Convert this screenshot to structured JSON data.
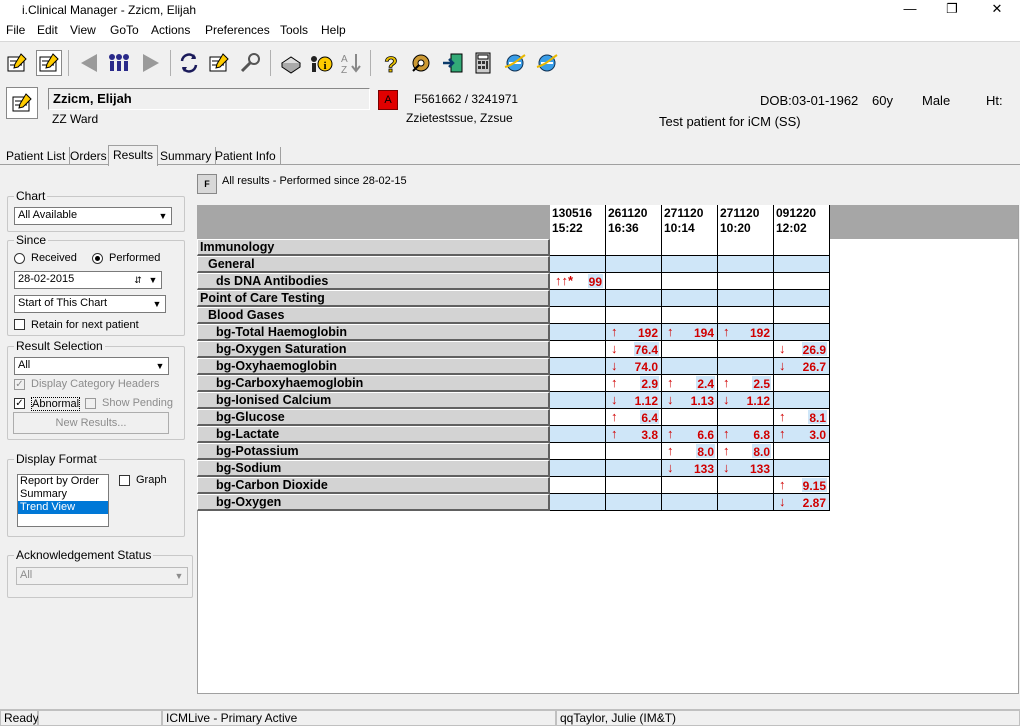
{
  "window": {
    "title": "i.Clinical Manager - Zzicm, Elijah",
    "min": "—",
    "max": "❐",
    "close": "✕"
  },
  "menu": [
    "File",
    "Edit",
    "View",
    "GoTo",
    "Actions",
    "Preferences",
    "Tools",
    "Help"
  ],
  "patient": {
    "name": "Zzicm, Elijah",
    "alert": "A",
    "ids": "F561662 / 3241971",
    "ward": "ZZ Ward",
    "gp": "Zzietestssue, Zzsue",
    "dob": "DOB:03-01-1962",
    "age": "60y",
    "sex": "Male",
    "ht": "Ht:",
    "note": "Test patient for iCM (SS)"
  },
  "tabs": [
    "Patient List",
    "Orders",
    "Results",
    "Summary",
    "Patient Info"
  ],
  "left": {
    "chart_label": "Chart",
    "chart_value": "All Available",
    "since_label": "Since",
    "received": "Received",
    "performed": "Performed",
    "date": "28-02-2015",
    "start": "Start of This Chart",
    "retain": "Retain for next patient",
    "result_sel_label": "Result Selection",
    "result_sel_value": "All",
    "display_cat": "Display Category Headers",
    "abnormal": "Abnormal",
    "show_pending": "Show Pending",
    "new_results": "New Results...",
    "display_format_label": "Display Format",
    "formats": [
      "Report by Order",
      "Summary",
      "Trend View"
    ],
    "graph": "Graph",
    "ack_label": "Acknowledgement Status",
    "ack_value": "All"
  },
  "results": {
    "filter_btn": "F",
    "subtitle": "All results - Performed since 28-02-15",
    "columns": [
      {
        "date": "130516",
        "time": "15:22"
      },
      {
        "date": "261120",
        "time": "16:36"
      },
      {
        "date": "271120",
        "time": "10:14"
      },
      {
        "date": "271120",
        "time": "10:20"
      },
      {
        "date": "091220",
        "time": "12:02"
      }
    ],
    "rows": [
      {
        "label": "Immunology",
        "level": 0,
        "cells": [
          "",
          "",
          "",
          "",
          ""
        ]
      },
      {
        "label": "General",
        "level": 1,
        "cells": [
          "",
          "",
          "",
          "",
          ""
        ]
      },
      {
        "label": "ds DNA Antibodies",
        "level": 2,
        "cells": [
          "↑↑* 99",
          "",
          "",
          "",
          ""
        ]
      },
      {
        "label": "Point of Care Testing",
        "level": 0,
        "cells": [
          "",
          "",
          "",
          "",
          ""
        ]
      },
      {
        "label": "Blood Gases",
        "level": 1,
        "cells": [
          "",
          "",
          "",
          "",
          ""
        ]
      },
      {
        "label": "bg-Total Haemoglobin",
        "level": 3,
        "cells": [
          "",
          "↑ 192",
          "↑ 194",
          "↑ 192",
          ""
        ]
      },
      {
        "label": "bg-Oxygen Saturation",
        "level": 3,
        "cells": [
          "",
          "↓ 76.4",
          "",
          "",
          "↓ 26.9"
        ]
      },
      {
        "label": "bg-Oxyhaemoglobin",
        "level": 3,
        "cells": [
          "",
          "↓ 74.0",
          "",
          "",
          "↓ 26.7"
        ]
      },
      {
        "label": "bg-Carboxyhaemoglobin",
        "level": 3,
        "cells": [
          "",
          "↑ 2.9",
          "↑ 2.4",
          "↑ 2.5",
          ""
        ]
      },
      {
        "label": "bg-Ionised Calcium",
        "level": 3,
        "cells": [
          "",
          "↓ 1.12",
          "↓ 1.13",
          "↓ 1.12",
          ""
        ]
      },
      {
        "label": "bg-Glucose",
        "level": 3,
        "cells": [
          "",
          "↑ 6.4",
          "",
          "",
          "↑ 8.1"
        ]
      },
      {
        "label": "bg-Lactate",
        "level": 3,
        "cells": [
          "",
          "↑ 3.8",
          "↑ 6.6",
          "↑ 6.8",
          "↑ 3.0"
        ]
      },
      {
        "label": "bg-Potassium",
        "level": 3,
        "cells": [
          "",
          "",
          "↑ 8.0",
          "↑ 8.0",
          ""
        ]
      },
      {
        "label": "bg-Sodium",
        "level": 3,
        "cells": [
          "",
          "",
          "↓ 133",
          "↓ 133",
          ""
        ]
      },
      {
        "label": "bg-Carbon Dioxide",
        "level": 3,
        "cells": [
          "",
          "",
          "",
          "",
          "↑ 9.15"
        ]
      },
      {
        "label": "bg-Oxygen",
        "level": 3,
        "cells": [
          "",
          "",
          "",
          "",
          "↓ 2.87"
        ]
      }
    ]
  },
  "status": {
    "ready": "Ready",
    "system": "ICMLive - Primary Active",
    "user": "qqTaylor, Julie (IM&T)"
  }
}
